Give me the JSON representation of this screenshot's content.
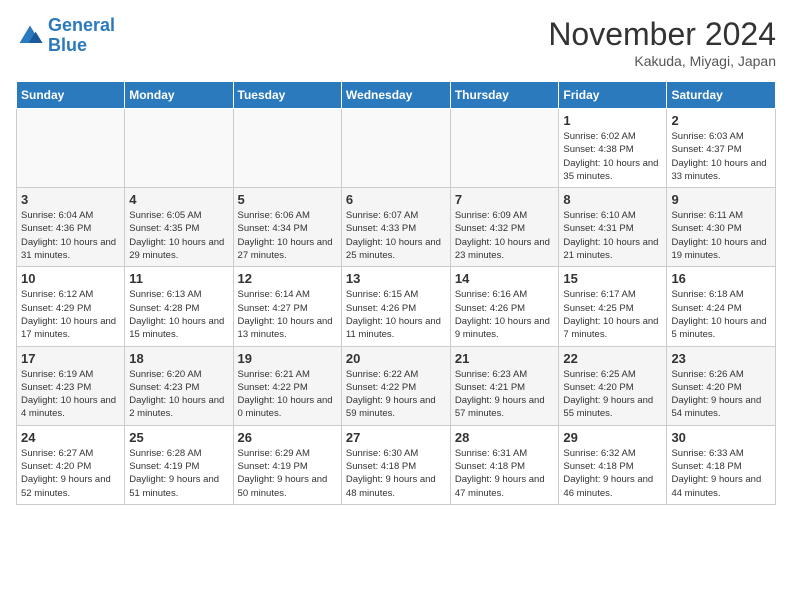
{
  "header": {
    "logo_line1": "General",
    "logo_line2": "Blue",
    "month_title": "November 2024",
    "location": "Kakuda, Miyagi, Japan"
  },
  "weekdays": [
    "Sunday",
    "Monday",
    "Tuesday",
    "Wednesday",
    "Thursday",
    "Friday",
    "Saturday"
  ],
  "weeks": [
    [
      {
        "day": "",
        "info": ""
      },
      {
        "day": "",
        "info": ""
      },
      {
        "day": "",
        "info": ""
      },
      {
        "day": "",
        "info": ""
      },
      {
        "day": "",
        "info": ""
      },
      {
        "day": "1",
        "info": "Sunrise: 6:02 AM\nSunset: 4:38 PM\nDaylight: 10 hours and 35 minutes."
      },
      {
        "day": "2",
        "info": "Sunrise: 6:03 AM\nSunset: 4:37 PM\nDaylight: 10 hours and 33 minutes."
      }
    ],
    [
      {
        "day": "3",
        "info": "Sunrise: 6:04 AM\nSunset: 4:36 PM\nDaylight: 10 hours and 31 minutes."
      },
      {
        "day": "4",
        "info": "Sunrise: 6:05 AM\nSunset: 4:35 PM\nDaylight: 10 hours and 29 minutes."
      },
      {
        "day": "5",
        "info": "Sunrise: 6:06 AM\nSunset: 4:34 PM\nDaylight: 10 hours and 27 minutes."
      },
      {
        "day": "6",
        "info": "Sunrise: 6:07 AM\nSunset: 4:33 PM\nDaylight: 10 hours and 25 minutes."
      },
      {
        "day": "7",
        "info": "Sunrise: 6:09 AM\nSunset: 4:32 PM\nDaylight: 10 hours and 23 minutes."
      },
      {
        "day": "8",
        "info": "Sunrise: 6:10 AM\nSunset: 4:31 PM\nDaylight: 10 hours and 21 minutes."
      },
      {
        "day": "9",
        "info": "Sunrise: 6:11 AM\nSunset: 4:30 PM\nDaylight: 10 hours and 19 minutes."
      }
    ],
    [
      {
        "day": "10",
        "info": "Sunrise: 6:12 AM\nSunset: 4:29 PM\nDaylight: 10 hours and 17 minutes."
      },
      {
        "day": "11",
        "info": "Sunrise: 6:13 AM\nSunset: 4:28 PM\nDaylight: 10 hours and 15 minutes."
      },
      {
        "day": "12",
        "info": "Sunrise: 6:14 AM\nSunset: 4:27 PM\nDaylight: 10 hours and 13 minutes."
      },
      {
        "day": "13",
        "info": "Sunrise: 6:15 AM\nSunset: 4:26 PM\nDaylight: 10 hours and 11 minutes."
      },
      {
        "day": "14",
        "info": "Sunrise: 6:16 AM\nSunset: 4:26 PM\nDaylight: 10 hours and 9 minutes."
      },
      {
        "day": "15",
        "info": "Sunrise: 6:17 AM\nSunset: 4:25 PM\nDaylight: 10 hours and 7 minutes."
      },
      {
        "day": "16",
        "info": "Sunrise: 6:18 AM\nSunset: 4:24 PM\nDaylight: 10 hours and 5 minutes."
      }
    ],
    [
      {
        "day": "17",
        "info": "Sunrise: 6:19 AM\nSunset: 4:23 PM\nDaylight: 10 hours and 4 minutes."
      },
      {
        "day": "18",
        "info": "Sunrise: 6:20 AM\nSunset: 4:23 PM\nDaylight: 10 hours and 2 minutes."
      },
      {
        "day": "19",
        "info": "Sunrise: 6:21 AM\nSunset: 4:22 PM\nDaylight: 10 hours and 0 minutes."
      },
      {
        "day": "20",
        "info": "Sunrise: 6:22 AM\nSunset: 4:22 PM\nDaylight: 9 hours and 59 minutes."
      },
      {
        "day": "21",
        "info": "Sunrise: 6:23 AM\nSunset: 4:21 PM\nDaylight: 9 hours and 57 minutes."
      },
      {
        "day": "22",
        "info": "Sunrise: 6:25 AM\nSunset: 4:20 PM\nDaylight: 9 hours and 55 minutes."
      },
      {
        "day": "23",
        "info": "Sunrise: 6:26 AM\nSunset: 4:20 PM\nDaylight: 9 hours and 54 minutes."
      }
    ],
    [
      {
        "day": "24",
        "info": "Sunrise: 6:27 AM\nSunset: 4:20 PM\nDaylight: 9 hours and 52 minutes."
      },
      {
        "day": "25",
        "info": "Sunrise: 6:28 AM\nSunset: 4:19 PM\nDaylight: 9 hours and 51 minutes."
      },
      {
        "day": "26",
        "info": "Sunrise: 6:29 AM\nSunset: 4:19 PM\nDaylight: 9 hours and 50 minutes."
      },
      {
        "day": "27",
        "info": "Sunrise: 6:30 AM\nSunset: 4:18 PM\nDaylight: 9 hours and 48 minutes."
      },
      {
        "day": "28",
        "info": "Sunrise: 6:31 AM\nSunset: 4:18 PM\nDaylight: 9 hours and 47 minutes."
      },
      {
        "day": "29",
        "info": "Sunrise: 6:32 AM\nSunset: 4:18 PM\nDaylight: 9 hours and 46 minutes."
      },
      {
        "day": "30",
        "info": "Sunrise: 6:33 AM\nSunset: 4:18 PM\nDaylight: 9 hours and 44 minutes."
      }
    ]
  ]
}
